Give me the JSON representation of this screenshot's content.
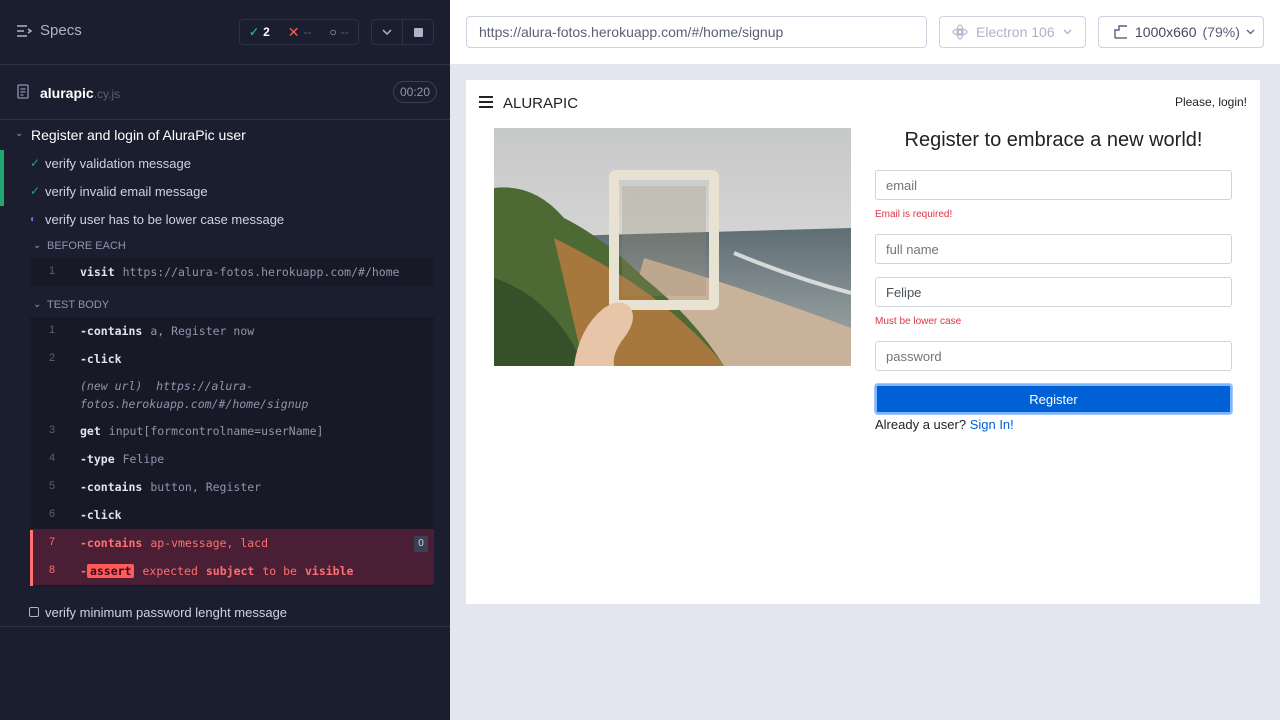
{
  "reporter": {
    "specs_label": "Specs",
    "stats": {
      "passed": "2",
      "failed": "--",
      "pending": "--"
    },
    "spec": {
      "name": "alurapic",
      "ext": ".cy.js",
      "duration": "00:20"
    },
    "suite_title": "Register and login of AluraPic user",
    "tests": [
      {
        "label": "verify validation message",
        "state": "passed"
      },
      {
        "label": "verify invalid email message",
        "state": "passed"
      },
      {
        "label": "verify user has to be lower case message",
        "state": "running"
      },
      {
        "label": "verify minimum password lenght message",
        "state": "pending"
      }
    ],
    "before_each_label": "BEFORE EACH",
    "test_body_label": "TEST BODY",
    "before_each_cmd": {
      "num": "1",
      "name": "visit",
      "msg": "https://alura-fotos.herokuapp.com/#/home"
    },
    "commands": [
      {
        "num": "1",
        "name": "-contains",
        "msg": "a, Register now"
      },
      {
        "num": "2",
        "name": "-click",
        "msg": ""
      },
      {
        "new_url_label": "(new url)",
        "new_url_line1": "https://alura-",
        "new_url_line2": "fotos.herokuapp.com/#/home/signup"
      },
      {
        "num": "3",
        "name": "get",
        "msg": "input[formcontrolname=userName]"
      },
      {
        "num": "4",
        "name": "-type",
        "msg": "Felipe"
      },
      {
        "num": "5",
        "name": "-contains",
        "msg": "button, Register"
      },
      {
        "num": "6",
        "name": "-click",
        "msg": ""
      },
      {
        "num": "7",
        "name": "-contains",
        "msg": "ap-vmessage, lacd",
        "badge": "0"
      },
      {
        "num": "8",
        "dash": "-",
        "assert": "assert",
        "msg": "expected",
        "subject": "subject",
        "tobe": "to be",
        "visible": "visible"
      }
    ]
  },
  "toolbar": {
    "url": "https://alura-fotos.herokuapp.com/#/home/signup",
    "browser": "Electron 106",
    "viewport": "1000x660",
    "zoom": "(79%)"
  },
  "app": {
    "brand": "ALURAPIC",
    "login_link": "Please, login!",
    "form_title": "Register to embrace a new world!",
    "email_placeholder": "email",
    "email_error": "Email is required!",
    "fullname_placeholder": "full name",
    "username_value": "Felipe",
    "username_error": "Must be lower case",
    "password_placeholder": "password",
    "register_label": "Register",
    "already_text": "Already a user?",
    "signin_text": "Sign In!"
  }
}
